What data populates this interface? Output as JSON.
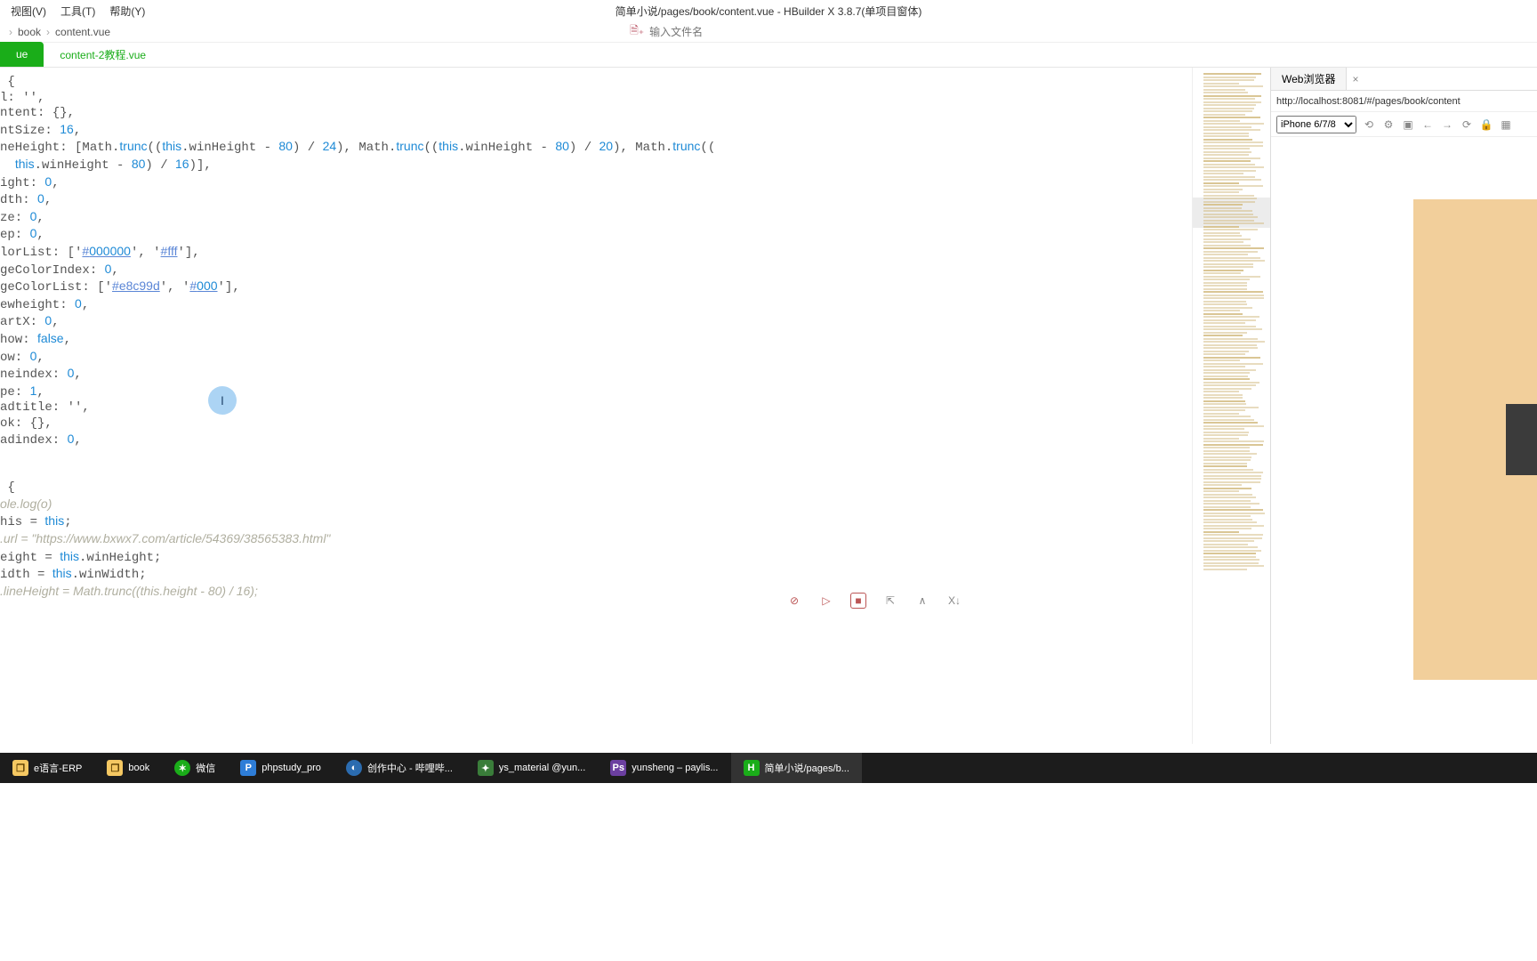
{
  "menu": {
    "view": "视图(V)",
    "tool": "工具(T)",
    "help": "帮助(Y)"
  },
  "window_title": "简单小说/pages/book/content.vue - HBuilder X 3.8.7(单项目窗体)",
  "breadcrumb": {
    "a": "book",
    "b": "content.vue"
  },
  "file_search_placeholder": "输入文件名",
  "tabs": {
    "active": "ue",
    "other": "content-2教程.vue"
  },
  "code_lines": [
    " {",
    "l: '',",
    "ntent: {},",
    "ntSize: 16,",
    "neHeight: [Math.trunc((this.winHeight - 80) / 24), Math.trunc((this.winHeight - 80) / 20), Math.trunc((",
    "  this.winHeight - 80) / 16)],",
    "ight: 0,",
    "dth: 0,",
    "ze: 0,",
    "ep: 0,",
    "lorList: ['#000000', '#fff'],",
    "geColorIndex: 0,",
    "geColorList: ['#e8c99d', '#000'],",
    "ewheight: 0,",
    "artX: 0,",
    "how: false,",
    "ow: 0,",
    "neindex: 0,",
    "pe: 1,",
    "adtitle: '',",
    "ok: {},",
    "adindex: 0,",
    "",
    "",
    " {",
    "ole.log(o)",
    "his = this;",
    ".url = \"https://www.bxwx7.com/article/54369/38565383.html\"",
    "eight = this.winHeight;",
    "idth = this.winWidth;",
    ".lineHeight = Math.trunc((this.height - 80) / 16);"
  ],
  "cursor_glyph": "I",
  "browser": {
    "tab": "Web浏览器",
    "url": "http://localhost:8081/#/pages/book/content",
    "device": "iPhone 6/7/8"
  },
  "action_icons": {
    "a1": "⊘",
    "a2": "▷",
    "a3": "■",
    "a4": "⇱",
    "a5": "∧",
    "a6": "X↓"
  },
  "taskbar": [
    {
      "icon": "folder",
      "label": "e语言-ERP"
    },
    {
      "icon": "folder",
      "label": "book"
    },
    {
      "icon": "wechat",
      "label": "微信"
    },
    {
      "icon": "blue",
      "label": "phpstudy_pro"
    },
    {
      "icon": "edge",
      "label": "创作中心 - 哔哩哔..."
    },
    {
      "icon": "gn",
      "label": "ys_material @yun..."
    },
    {
      "icon": "ps",
      "label": "yunsheng – paylis..."
    },
    {
      "icon": "hb",
      "label": "简单小说/pages/b..."
    }
  ]
}
